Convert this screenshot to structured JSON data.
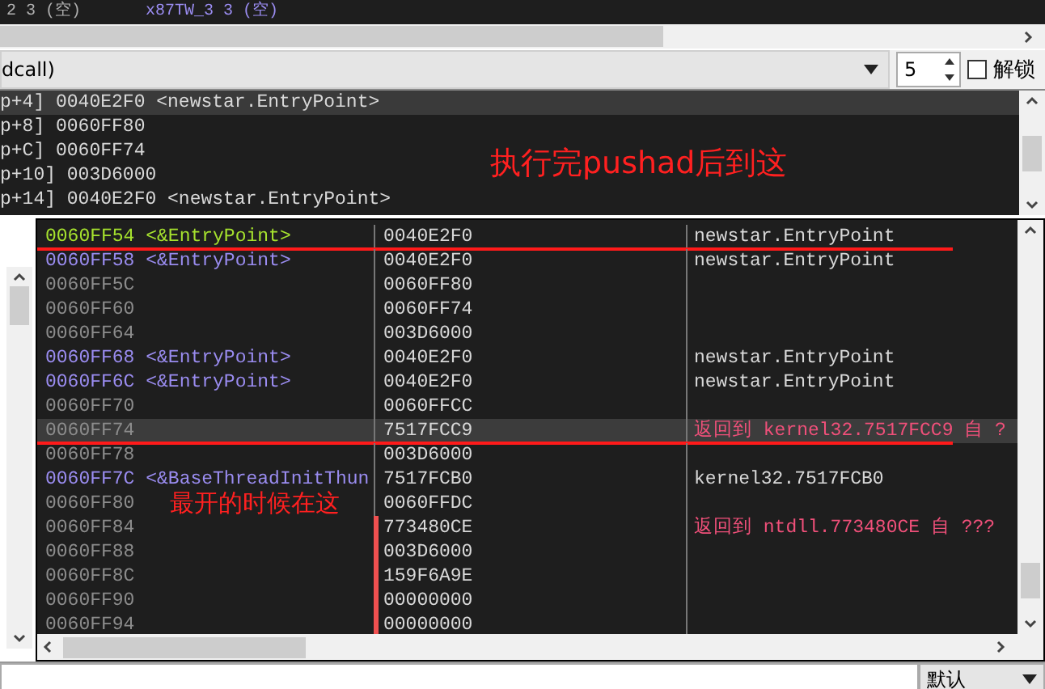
{
  "registers_strip": {
    "items": [
      "2 3 (空)",
      "x87TW_3 3 (空)"
    ]
  },
  "call_convention": {
    "value": "dcall)"
  },
  "arg_count": {
    "value": "5"
  },
  "unlock": {
    "label": "解锁",
    "checked": false
  },
  "arguments": [
    {
      "text": "p+4] 0040E2F0 <newstar.EntryPoint>",
      "selected": true
    },
    {
      "text": "p+8] 0060FF80",
      "selected": false
    },
    {
      "text": "p+C] 0060FF74",
      "selected": false
    },
    {
      "text": "p+10] 003D6000",
      "selected": false
    },
    {
      "text": "p+14] 0040E2F0 <newstar.EntryPoint>",
      "selected": false
    }
  ],
  "stack": [
    {
      "address": "0060FF54",
      "label": "<&EntryPoint>",
      "kind": "current",
      "value": "0040E2F0",
      "comment": "newstar.EntryPoint",
      "is_return": false,
      "selected": false,
      "underlined": true,
      "bracketed": false
    },
    {
      "address": "0060FF58",
      "label": "<&EntryPoint>",
      "kind": "labeled",
      "value": "0040E2F0",
      "comment": "newstar.EntryPoint",
      "is_return": false,
      "selected": false,
      "underlined": false,
      "bracketed": false
    },
    {
      "address": "0060FF5C",
      "kind": "plain",
      "value": "0060FF80",
      "selected": false,
      "underlined": false,
      "bracketed": false
    },
    {
      "address": "0060FF60",
      "kind": "plain",
      "value": "0060FF74",
      "selected": false,
      "underlined": false,
      "bracketed": false
    },
    {
      "address": "0060FF64",
      "kind": "plain",
      "value": "003D6000",
      "selected": false,
      "underlined": false,
      "bracketed": false
    },
    {
      "address": "0060FF68",
      "label": "<&EntryPoint>",
      "kind": "labeled",
      "value": "0040E2F0",
      "comment": "newstar.EntryPoint",
      "is_return": false,
      "selected": false,
      "underlined": false,
      "bracketed": false
    },
    {
      "address": "0060FF6C",
      "label": "<&EntryPoint>",
      "kind": "labeled",
      "value": "0040E2F0",
      "comment": "newstar.EntryPoint",
      "is_return": false,
      "selected": false,
      "underlined": false,
      "bracketed": false
    },
    {
      "address": "0060FF70",
      "kind": "plain",
      "value": "0060FFCC",
      "selected": false,
      "underlined": false,
      "bracketed": false
    },
    {
      "address": "0060FF74",
      "kind": "plain",
      "value": "7517FCC9",
      "comment": "返回到 kernel32.7517FCC9 自 ?",
      "is_return": true,
      "selected": true,
      "underlined": true,
      "bracketed": false
    },
    {
      "address": "0060FF78",
      "kind": "plain",
      "value": "003D6000",
      "selected": false,
      "underlined": false,
      "bracketed": false
    },
    {
      "address": "0060FF7C",
      "label": "<&BaseThreadInitThun",
      "kind": "labeled",
      "value": "7517FCB0",
      "comment": "kernel32.7517FCB0",
      "is_return": false,
      "selected": false,
      "underlined": false,
      "bracketed": false
    },
    {
      "address": "0060FF80",
      "kind": "plain",
      "note": "最开的时候在这",
      "value": "0060FFDC",
      "selected": false,
      "underlined": false,
      "bracketed": false
    },
    {
      "address": "0060FF84",
      "kind": "plain",
      "value": "773480CE",
      "comment": "返回到 ntdll.773480CE 自 ???",
      "is_return": true,
      "selected": false,
      "underlined": false,
      "bracketed": true
    },
    {
      "address": "0060FF88",
      "kind": "plain",
      "value": "003D6000",
      "selected": false,
      "underlined": false,
      "bracketed": true
    },
    {
      "address": "0060FF8C",
      "kind": "plain",
      "value": "159F6A9E",
      "selected": false,
      "underlined": false,
      "bracketed": true
    },
    {
      "address": "0060FF90",
      "kind": "plain",
      "value": "00000000",
      "selected": false,
      "underlined": false,
      "bracketed": true
    },
    {
      "address": "0060FF94",
      "kind": "plain",
      "value": "00000000",
      "selected": false,
      "underlined": false,
      "bracketed": true
    }
  ],
  "annotations": [
    {
      "text": "执行完pushad后到这"
    }
  ],
  "command_bar": {
    "mode": "默认"
  }
}
